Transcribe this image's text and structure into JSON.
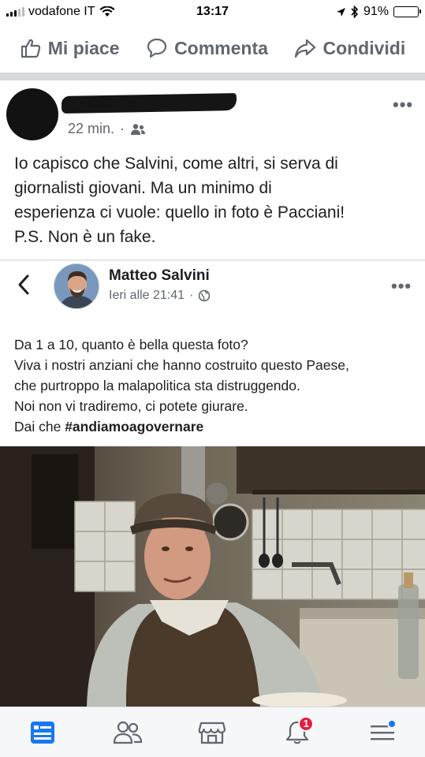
{
  "status_bar": {
    "carrier": "vodafone IT",
    "time": "13:17",
    "battery_percent": "91%",
    "battery_level": 0.91,
    "icons": [
      "signal-icon",
      "wifi-icon",
      "location-arrow-icon",
      "bluetooth-icon",
      "battery-icon"
    ]
  },
  "actions": {
    "like_label": "Mi piace",
    "comment_label": "Commenta",
    "share_label": "Condividi"
  },
  "post": {
    "time": "22 min.",
    "separator": "·",
    "audience_icon": "friends-icon",
    "more_icon": "•••",
    "text": "Io capisco che Salvini, come altri, si serva di\ngiornalisti giovani. Ma un minimo di\nesperienza ci vuole: quello in foto è Pacciani!\nP.S. Non è un fake."
  },
  "shared_post": {
    "author": "Matteo Salvini",
    "time": "Ieri alle 21:41",
    "separator": "·",
    "audience_icon": "globe-icon",
    "more_icon": "•••",
    "lines": [
      "Da 1 a 10, quanto è bella questa foto?",
      "Viva i nostri anziani che hanno costruito questo Paese,",
      "che purtroppo la malapolitica sta distruggendo.",
      "Noi non vi tradiremo, ci potete giurare."
    ],
    "last_line_prefix": "Dai che ",
    "hashtag": "#andiamoagovernare"
  },
  "bottom_nav": {
    "items": [
      "news-feed-icon",
      "friends-icon",
      "marketplace-icon",
      "notifications-icon",
      "menu-icon"
    ],
    "notifications_badge": "1",
    "accent_color": "#1877f2"
  },
  "colors": {
    "facebook_blue": "#1877f2",
    "meta_gray": "#606770",
    "badge_red": "#e41e3f"
  }
}
